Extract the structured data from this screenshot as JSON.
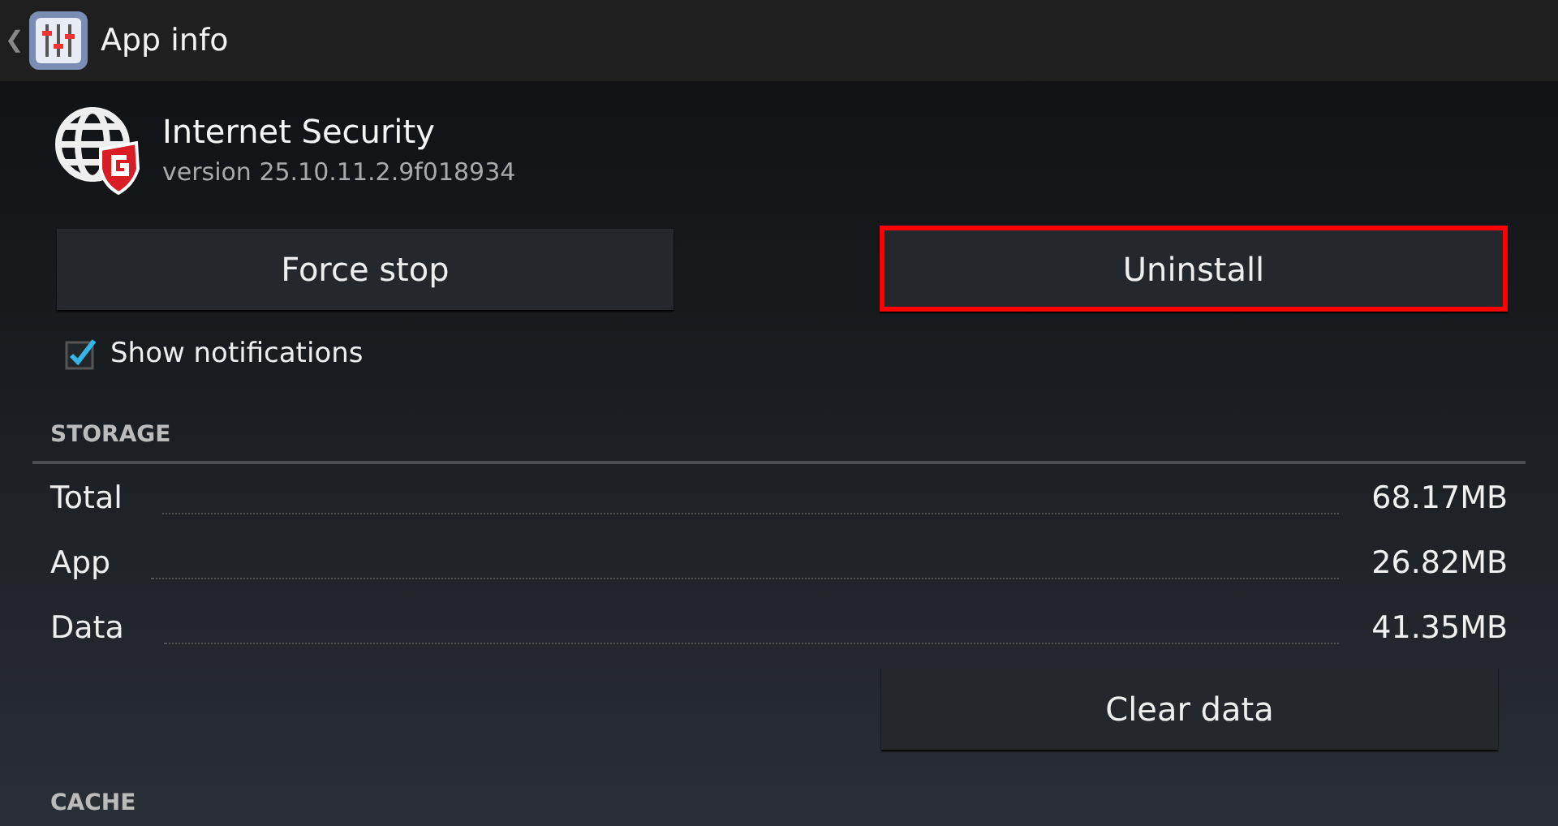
{
  "action_bar": {
    "title": "App info",
    "back": "❮"
  },
  "app": {
    "name": "Internet Security",
    "version": "version 25.10.11.2.9f018934"
  },
  "buttons": [
    {
      "label": "Force stop",
      "highlighted": false
    },
    {
      "label": "Uninstall",
      "highlighted": true
    }
  ],
  "notifications": {
    "label": "Show notifications",
    "checked": true
  },
  "storage": {
    "header": "STORAGE",
    "rows": [
      {
        "label": "Total",
        "value": "68.17MB"
      },
      {
        "label": "App",
        "value": "26.82MB"
      },
      {
        "label": "Data",
        "value": "41.35MB"
      }
    ],
    "button": {
      "label": "Clear data"
    }
  },
  "cache": {
    "header": "CACHE"
  }
}
